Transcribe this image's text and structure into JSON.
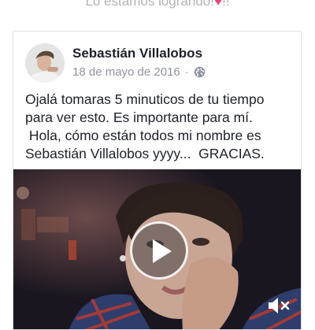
{
  "top_caption": {
    "text": "Lo estamos logrando!",
    "heart": "♥",
    "trail": "!!"
  },
  "post": {
    "author": "Sebastián Villalobos",
    "date": "18 de mayo de 2016",
    "separator": "·",
    "audience_icon": "globe-icon",
    "text": "Ojalá tomaras 5 minuticos de tu tiempo\npara ver esto. Es importante para mí.\n Hola, cómo están todos mi nombre es\nSebastián Villalobos yyyy...  GRACIAS.",
    "video": {
      "controls": [
        "play-icon",
        "mute-icon"
      ]
    }
  },
  "colors": {
    "heart": "#e8457a",
    "author": "#1d2129",
    "meta": "#90949c",
    "card_border": "#dddfe2"
  }
}
